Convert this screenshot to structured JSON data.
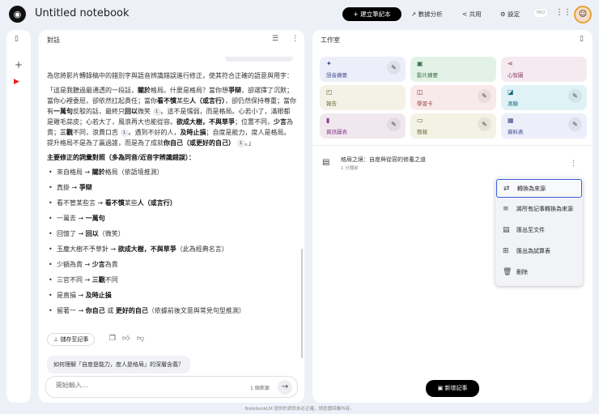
{
  "header": {
    "title": "Untitled notebook",
    "create_label": "建立筆記本",
    "analytics_label": "數據分析",
    "share_label": "共用",
    "settings_label": "設定",
    "pro_badge": "PRO"
  },
  "chat": {
    "title": "對話",
    "intro": "為您將影片轉錄稿中的錯別字與語音辨識錯誤進行修正，使其符合正確的語意與用字：",
    "quote": [
      {
        "t": "「這是我聽過最通透的一段話，"
      },
      {
        "t": "關於",
        "b": 1
      },
      {
        "t": "格局。什麼是格局？當你想"
      },
      {
        "t": "爭辯",
        "b": 1
      },
      {
        "t": "，卻選擇了沉默；當你心裡委屈，卻依然扛起責任；當你"
      },
      {
        "t": "看不慣",
        "b": 1
      },
      {
        "t": "某些"
      },
      {
        "t": "人（或言行）",
        "b": 1
      },
      {
        "t": "，卻仍然保持尊重；當你有"
      },
      {
        "t": "一萬句",
        "b": 1
      },
      {
        "t": "反駁的話，最終只"
      },
      {
        "t": "回以",
        "b": 1
      },
      {
        "t": "微笑 "
      },
      {
        "t": "1",
        "c": 1
      },
      {
        "t": "。這不是懦弱，而是格局。心若小了，滿眼都是雞毛蒜皮；心若大了，風浪再大也能從容。"
      },
      {
        "t": "欲成大樹，不與草爭",
        "b": 1
      },
      {
        "t": "；位置不同，"
      },
      {
        "t": "少言",
        "b": 1
      },
      {
        "t": "為貴；"
      },
      {
        "t": "三觀",
        "b": 1
      },
      {
        "t": "不同，浪費口舌 "
      },
      {
        "t": "1",
        "c": 1
      },
      {
        "t": "。遇到不好的人，"
      },
      {
        "t": "及時止損",
        "b": 1
      },
      {
        "t": "；自度是能力，度人是格局。提升格局不是為了贏過誰，而是為了成就"
      },
      {
        "t": "你自己（或更好的自己）",
        "b": 1
      },
      {
        "t": " "
      },
      {
        "t": "1",
        "c": 1
      },
      {
        "t": "。」"
      }
    ],
    "list_heading": "主要修正的詞彙對照（多為同音/近音字辨識錯誤）：",
    "corrections": [
      [
        {
          "t": "來自格局 → "
        },
        {
          "t": "關於",
          "b": 1
        },
        {
          "t": "格局（依語境推測）"
        }
      ],
      [
        {
          "t": "真掛 → "
        },
        {
          "t": "爭辯",
          "b": 1
        }
      ],
      [
        {
          "t": "看不管某些言 → "
        },
        {
          "t": "看不慣",
          "b": 1
        },
        {
          "t": "某些"
        },
        {
          "t": "人（或言行）",
          "b": 1
        }
      ],
      [
        {
          "t": "一萬去 → "
        },
        {
          "t": "一萬句",
          "b": 1
        }
      ],
      [
        {
          "t": "回憶了 → "
        },
        {
          "t": "回以",
          "b": 1
        },
        {
          "t": "（微笑）"
        }
      ],
      [
        {
          "t": "玉塵大樹不予草針 → "
        },
        {
          "t": "欲成大樹，不與草爭",
          "b": 1
        },
        {
          "t": "（此為經典名言）"
        }
      ],
      [
        {
          "t": "少額為貴 → "
        },
        {
          "t": "少言",
          "b": 1
        },
        {
          "t": "為貴"
        }
      ],
      [
        {
          "t": "三官不同 → "
        },
        {
          "t": "三觀",
          "b": 1
        },
        {
          "t": "不同"
        }
      ],
      [
        {
          "t": "是直損 → "
        },
        {
          "t": "及時止損",
          "b": 1
        }
      ],
      [
        {
          "t": "留著一 → "
        },
        {
          "t": "你自己",
          "b": 1
        },
        {
          "t": " 或 "
        },
        {
          "t": "更好的自己",
          "b": 1
        },
        {
          "t": "（依據前後文意與常見句型推測）"
        }
      ]
    ],
    "save_label": "儲存至記事",
    "suggestion": "如何理解「自度是能力，度人是格局」的深層含義？",
    "input_placeholder": "開始輸入...",
    "source_count": "1 個來源"
  },
  "studio": {
    "title": "工作室",
    "tiles": [
      {
        "label": "語音摘要",
        "icon": "sparkle-icon",
        "bg": "#eceef9",
        "fg": "#3c4a8c",
        "edit": true
      },
      {
        "label": "影片摘要",
        "icon": "video-icon",
        "bg": "#e3f2e6",
        "fg": "#2d6a3e",
        "edit": false
      },
      {
        "label": "心智圖",
        "icon": "mindmap-icon",
        "bg": "#f5eaf0",
        "fg": "#8a3a6a",
        "edit": false
      },
      {
        "label": "報告",
        "icon": "report-icon",
        "bg": "#f3f2e6",
        "fg": "#6a6a3a",
        "edit": false
      },
      {
        "label": "學習卡",
        "icon": "flashcard-icon",
        "bg": "#f8eaea",
        "fg": "#9a3a3a",
        "edit": true
      },
      {
        "label": "測驗",
        "icon": "quiz-icon",
        "bg": "#dff3f6",
        "fg": "#1a6a7a",
        "edit": true
      },
      {
        "label": "資訊圖表",
        "icon": "chart-icon",
        "bg": "#f1e8ef",
        "fg": "#8a3a8a",
        "edit": true
      },
      {
        "label": "簡報",
        "icon": "slides-icon",
        "bg": "#f3f2e4",
        "fg": "#6a6a3a",
        "edit": true
      },
      {
        "label": "資料表",
        "icon": "table-icon",
        "bg": "#eceefa",
        "fg": "#3c4a8c",
        "edit": true
      }
    ],
    "note": {
      "title": "格局之境：自度與從容的修養之道",
      "time": "1 分鐘前"
    },
    "menu": [
      {
        "label": "轉換為來源",
        "icon": "convert-icon"
      },
      {
        "label": "將所有記事轉換為來源",
        "icon": "playlist-add-icon"
      },
      {
        "label": "匯出至文件",
        "icon": "document-icon"
      },
      {
        "label": "匯出為試算表",
        "icon": "spreadsheet-icon"
      },
      {
        "label": "刪除",
        "icon": "trash-icon"
      }
    ],
    "new_note_label": "新增記事"
  },
  "footer": "NotebookLM 提供的資訊未必正確，請查證回覆內容。",
  "colors": {
    "accent": "#3d5ad6",
    "background": "#eef0f8"
  }
}
